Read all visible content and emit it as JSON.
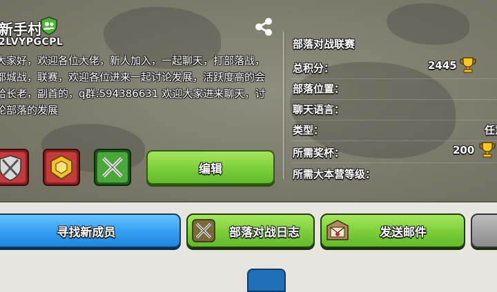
{
  "clan": {
    "name": "新手村",
    "tag": "2LVYPGCPL",
    "description": "大家好，欢迎各位大佬，新人加入，一起聊天，打部落战，都城战，联赛，欢迎各位进来一起讨论发展，活跃度高的会给长老，副首的，q群:594386631 欢迎大家进来聊天，讨论部落的发展"
  },
  "info": {
    "title": "部落对战联赛",
    "total_points_label": "总积分：",
    "total_points_value": "2445",
    "location_label": "部落位置：",
    "language_label": "聊天语言：",
    "type_label": "类型：",
    "type_value": "任意",
    "required_trophies_label": "所需奖杯：",
    "required_trophies_value": "200",
    "required_th_label": "所需大本营等级："
  },
  "buttons": {
    "edit": "编辑",
    "find_members": "寻找新成员",
    "war_log": "部落对战日志",
    "send_mail": "发送邮件"
  },
  "icons": {
    "badge": "clan-members-badge-icon",
    "share": "share-icon",
    "trophy": "trophy-icon",
    "war_log": "crossed-swords-icon",
    "mail": "envelope-icon",
    "emblems": [
      "crossed-swords-shield-icon",
      "gold-crest-icon",
      "green-swords-icon"
    ]
  },
  "colors": {
    "green_button": "#7ed13c",
    "blue_button": "#37a0f2",
    "panel": "#7d7b6c"
  }
}
